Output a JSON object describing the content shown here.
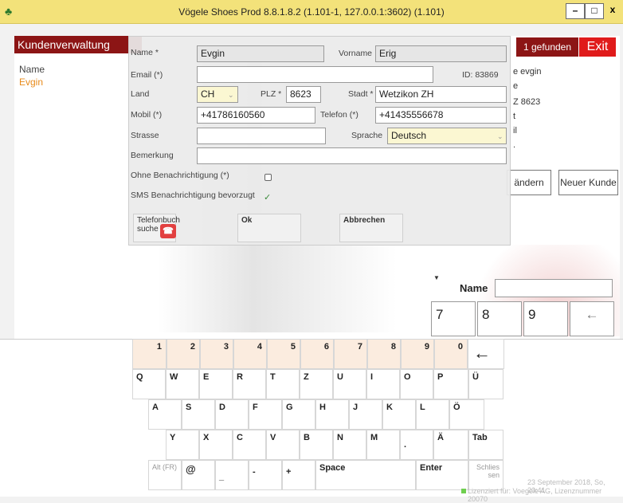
{
  "window": {
    "title": "Vögele Shoes Prod 8.8.1.8.2 (1.101-1, 127.0.0.1:3602) (1.101)",
    "min_label": "–",
    "max_label": "□",
    "close_label": "x"
  },
  "left": {
    "header": "Kundenverwaltung",
    "column_header": "Name",
    "items": [
      "Evgin"
    ]
  },
  "top_right": {
    "found": "1 gefunden",
    "exit": "Exit"
  },
  "details": [
    "e evgin",
    "e",
    "Z 8623",
    "t",
    "il",
    "."
  ],
  "actions": {
    "edit": "ändern",
    "new_customer": "Neuer Kunde"
  },
  "form": {
    "name_label": "Name *",
    "name_value": "Evgin",
    "vorname_label": "Vorname",
    "vorname_value": "Erig",
    "email_label": "Email (*)",
    "email_value": "",
    "id_text": "ID: 83869",
    "land_label": "Land",
    "land_value": "CH",
    "plz_label": "PLZ *",
    "plz_value": "8623",
    "stadt_label": "Stadt *",
    "stadt_value": "Wetzikon ZH",
    "mobil_label": "Mobil (*)",
    "mobil_value": "+41786160560",
    "telefon_label": "Telefon (*)",
    "telefon_value": "+41435556678",
    "strasse_label": "Strasse",
    "strasse_value": "",
    "sprache_label": "Sprache",
    "sprache_value": "Deutsch",
    "bemerkung_label": "Bemerkung",
    "bemerkung_value": "",
    "ohne_label": "Ohne Benachrichtigung (*)",
    "sms_label": "SMS Benachrichtigung bevorzugt",
    "phonebook_label_1": "Telefonbuch",
    "phonebook_label_2": "suche",
    "ok_label": "Ok",
    "cancel_label": "Abbrechen"
  },
  "numpad": {
    "name_label": "Name",
    "keys": [
      "7",
      "8",
      "9",
      "←"
    ]
  },
  "keyboard": {
    "numbers": [
      "1",
      "2",
      "3",
      "4",
      "5",
      "6",
      "7",
      "8",
      "9",
      "0"
    ],
    "backspace": "←",
    "row1": [
      "Q",
      "W",
      "E",
      "R",
      "T",
      "Z",
      "U",
      "I",
      "O",
      "P",
      "Ü"
    ],
    "row2": [
      "A",
      "S",
      "D",
      "F",
      "G",
      "H",
      "J",
      "K",
      "L",
      "Ö"
    ],
    "row3": [
      "Y",
      "X",
      "C",
      "V",
      "B",
      "N",
      "M",
      ".",
      "Ä",
      "Tab"
    ],
    "alt": "Alt (FR)",
    "at": "@",
    "underscore": "_",
    "dash": "-",
    "plus": "+",
    "space": "Space",
    "enter": "Enter",
    "close_1": "Schlies",
    "close_2": "sen"
  },
  "status": {
    "date": "23 September 2018, So, 20:41",
    "license": "Lizenziert für: Voegele AG, Lizenznummer 20070"
  },
  "colors": {
    "titlebar": "#f3e27a",
    "header": "#8c1515",
    "exit": "#e01b1b",
    "accent": "#e88a1a"
  }
}
